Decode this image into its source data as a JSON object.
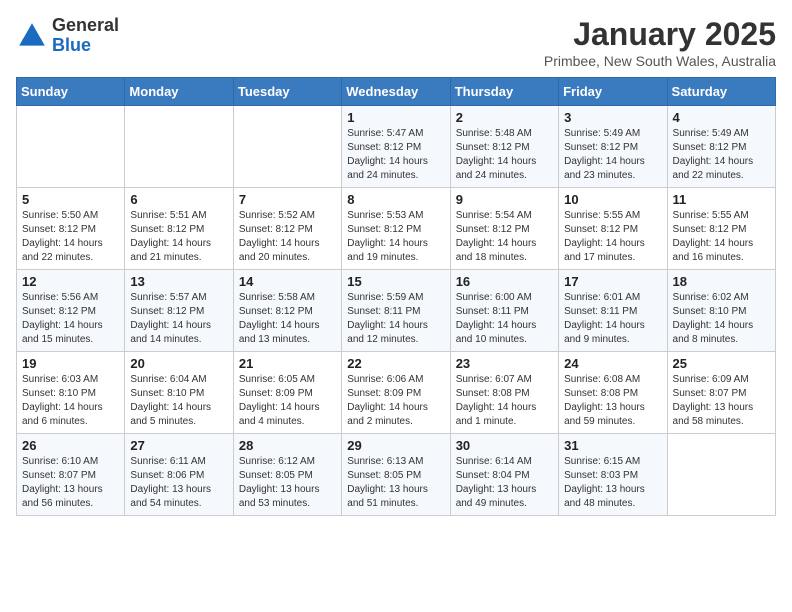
{
  "header": {
    "logo": {
      "general": "General",
      "blue": "Blue"
    },
    "title": "January 2025",
    "subtitle": "Primbee, New South Wales, Australia"
  },
  "weekdays": [
    "Sunday",
    "Monday",
    "Tuesday",
    "Wednesday",
    "Thursday",
    "Friday",
    "Saturday"
  ],
  "weeks": [
    [
      {
        "day": "",
        "sunrise": "",
        "sunset": "",
        "daylight": ""
      },
      {
        "day": "",
        "sunrise": "",
        "sunset": "",
        "daylight": ""
      },
      {
        "day": "",
        "sunrise": "",
        "sunset": "",
        "daylight": ""
      },
      {
        "day": "1",
        "sunrise": "Sunrise: 5:47 AM",
        "sunset": "Sunset: 8:12 PM",
        "daylight": "Daylight: 14 hours and 24 minutes."
      },
      {
        "day": "2",
        "sunrise": "Sunrise: 5:48 AM",
        "sunset": "Sunset: 8:12 PM",
        "daylight": "Daylight: 14 hours and 24 minutes."
      },
      {
        "day": "3",
        "sunrise": "Sunrise: 5:49 AM",
        "sunset": "Sunset: 8:12 PM",
        "daylight": "Daylight: 14 hours and 23 minutes."
      },
      {
        "day": "4",
        "sunrise": "Sunrise: 5:49 AM",
        "sunset": "Sunset: 8:12 PM",
        "daylight": "Daylight: 14 hours and 22 minutes."
      }
    ],
    [
      {
        "day": "5",
        "sunrise": "Sunrise: 5:50 AM",
        "sunset": "Sunset: 8:12 PM",
        "daylight": "Daylight: 14 hours and 22 minutes."
      },
      {
        "day": "6",
        "sunrise": "Sunrise: 5:51 AM",
        "sunset": "Sunset: 8:12 PM",
        "daylight": "Daylight: 14 hours and 21 minutes."
      },
      {
        "day": "7",
        "sunrise": "Sunrise: 5:52 AM",
        "sunset": "Sunset: 8:12 PM",
        "daylight": "Daylight: 14 hours and 20 minutes."
      },
      {
        "day": "8",
        "sunrise": "Sunrise: 5:53 AM",
        "sunset": "Sunset: 8:12 PM",
        "daylight": "Daylight: 14 hours and 19 minutes."
      },
      {
        "day": "9",
        "sunrise": "Sunrise: 5:54 AM",
        "sunset": "Sunset: 8:12 PM",
        "daylight": "Daylight: 14 hours and 18 minutes."
      },
      {
        "day": "10",
        "sunrise": "Sunrise: 5:55 AM",
        "sunset": "Sunset: 8:12 PM",
        "daylight": "Daylight: 14 hours and 17 minutes."
      },
      {
        "day": "11",
        "sunrise": "Sunrise: 5:55 AM",
        "sunset": "Sunset: 8:12 PM",
        "daylight": "Daylight: 14 hours and 16 minutes."
      }
    ],
    [
      {
        "day": "12",
        "sunrise": "Sunrise: 5:56 AM",
        "sunset": "Sunset: 8:12 PM",
        "daylight": "Daylight: 14 hours and 15 minutes."
      },
      {
        "day": "13",
        "sunrise": "Sunrise: 5:57 AM",
        "sunset": "Sunset: 8:12 PM",
        "daylight": "Daylight: 14 hours and 14 minutes."
      },
      {
        "day": "14",
        "sunrise": "Sunrise: 5:58 AM",
        "sunset": "Sunset: 8:12 PM",
        "daylight": "Daylight: 14 hours and 13 minutes."
      },
      {
        "day": "15",
        "sunrise": "Sunrise: 5:59 AM",
        "sunset": "Sunset: 8:11 PM",
        "daylight": "Daylight: 14 hours and 12 minutes."
      },
      {
        "day": "16",
        "sunrise": "Sunrise: 6:00 AM",
        "sunset": "Sunset: 8:11 PM",
        "daylight": "Daylight: 14 hours and 10 minutes."
      },
      {
        "day": "17",
        "sunrise": "Sunrise: 6:01 AM",
        "sunset": "Sunset: 8:11 PM",
        "daylight": "Daylight: 14 hours and 9 minutes."
      },
      {
        "day": "18",
        "sunrise": "Sunrise: 6:02 AM",
        "sunset": "Sunset: 8:10 PM",
        "daylight": "Daylight: 14 hours and 8 minutes."
      }
    ],
    [
      {
        "day": "19",
        "sunrise": "Sunrise: 6:03 AM",
        "sunset": "Sunset: 8:10 PM",
        "daylight": "Daylight: 14 hours and 6 minutes."
      },
      {
        "day": "20",
        "sunrise": "Sunrise: 6:04 AM",
        "sunset": "Sunset: 8:10 PM",
        "daylight": "Daylight: 14 hours and 5 minutes."
      },
      {
        "day": "21",
        "sunrise": "Sunrise: 6:05 AM",
        "sunset": "Sunset: 8:09 PM",
        "daylight": "Daylight: 14 hours and 4 minutes."
      },
      {
        "day": "22",
        "sunrise": "Sunrise: 6:06 AM",
        "sunset": "Sunset: 8:09 PM",
        "daylight": "Daylight: 14 hours and 2 minutes."
      },
      {
        "day": "23",
        "sunrise": "Sunrise: 6:07 AM",
        "sunset": "Sunset: 8:08 PM",
        "daylight": "Daylight: 14 hours and 1 minute."
      },
      {
        "day": "24",
        "sunrise": "Sunrise: 6:08 AM",
        "sunset": "Sunset: 8:08 PM",
        "daylight": "Daylight: 13 hours and 59 minutes."
      },
      {
        "day": "25",
        "sunrise": "Sunrise: 6:09 AM",
        "sunset": "Sunset: 8:07 PM",
        "daylight": "Daylight: 13 hours and 58 minutes."
      }
    ],
    [
      {
        "day": "26",
        "sunrise": "Sunrise: 6:10 AM",
        "sunset": "Sunset: 8:07 PM",
        "daylight": "Daylight: 13 hours and 56 minutes."
      },
      {
        "day": "27",
        "sunrise": "Sunrise: 6:11 AM",
        "sunset": "Sunset: 8:06 PM",
        "daylight": "Daylight: 13 hours and 54 minutes."
      },
      {
        "day": "28",
        "sunrise": "Sunrise: 6:12 AM",
        "sunset": "Sunset: 8:05 PM",
        "daylight": "Daylight: 13 hours and 53 minutes."
      },
      {
        "day": "29",
        "sunrise": "Sunrise: 6:13 AM",
        "sunset": "Sunset: 8:05 PM",
        "daylight": "Daylight: 13 hours and 51 minutes."
      },
      {
        "day": "30",
        "sunrise": "Sunrise: 6:14 AM",
        "sunset": "Sunset: 8:04 PM",
        "daylight": "Daylight: 13 hours and 49 minutes."
      },
      {
        "day": "31",
        "sunrise": "Sunrise: 6:15 AM",
        "sunset": "Sunset: 8:03 PM",
        "daylight": "Daylight: 13 hours and 48 minutes."
      },
      {
        "day": "",
        "sunrise": "",
        "sunset": "",
        "daylight": ""
      }
    ]
  ]
}
